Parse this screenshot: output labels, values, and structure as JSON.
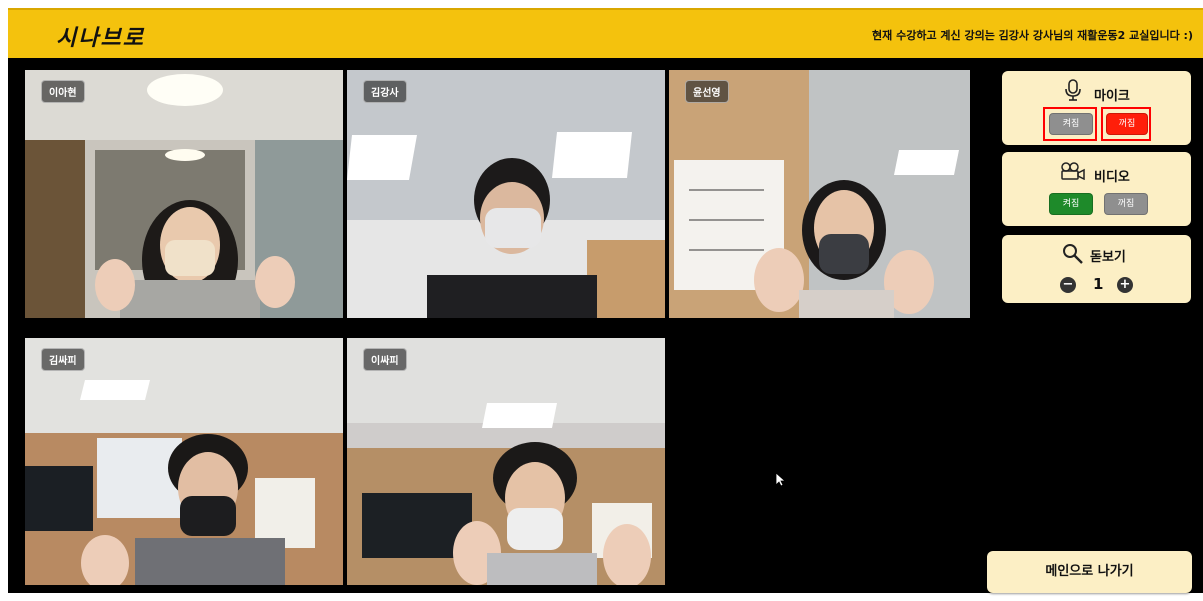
{
  "app": {
    "logo": "시나브로",
    "notice": "현재 수강하고 계신 강의는 김강사 강사님의 재활운동2 교실입니다 :)"
  },
  "participants": [
    {
      "name": "이아현"
    },
    {
      "name": "김강사"
    },
    {
      "name": "윤선영"
    },
    {
      "name": "김싸피"
    },
    {
      "name": "이싸피"
    }
  ],
  "controls": {
    "mic": {
      "label": "마이크",
      "on_label": "켜짐",
      "off_label": "꺼짐",
      "state": "off",
      "icon": "microphone-icon"
    },
    "video": {
      "label": "비디오",
      "on_label": "켜짐",
      "off_label": "꺼짐",
      "state": "on",
      "icon": "camera-icon"
    },
    "zoom": {
      "label": "돋보기",
      "value": "1",
      "icon": "magnifier-icon"
    }
  },
  "exit": {
    "label": "메인으로 나가기"
  },
  "colors": {
    "header": "#f4c20d",
    "panel": "#fcefc5",
    "on_green": "#1e8a2a",
    "off_red": "#ff1e0a",
    "inactive": "#8f8f8f"
  }
}
